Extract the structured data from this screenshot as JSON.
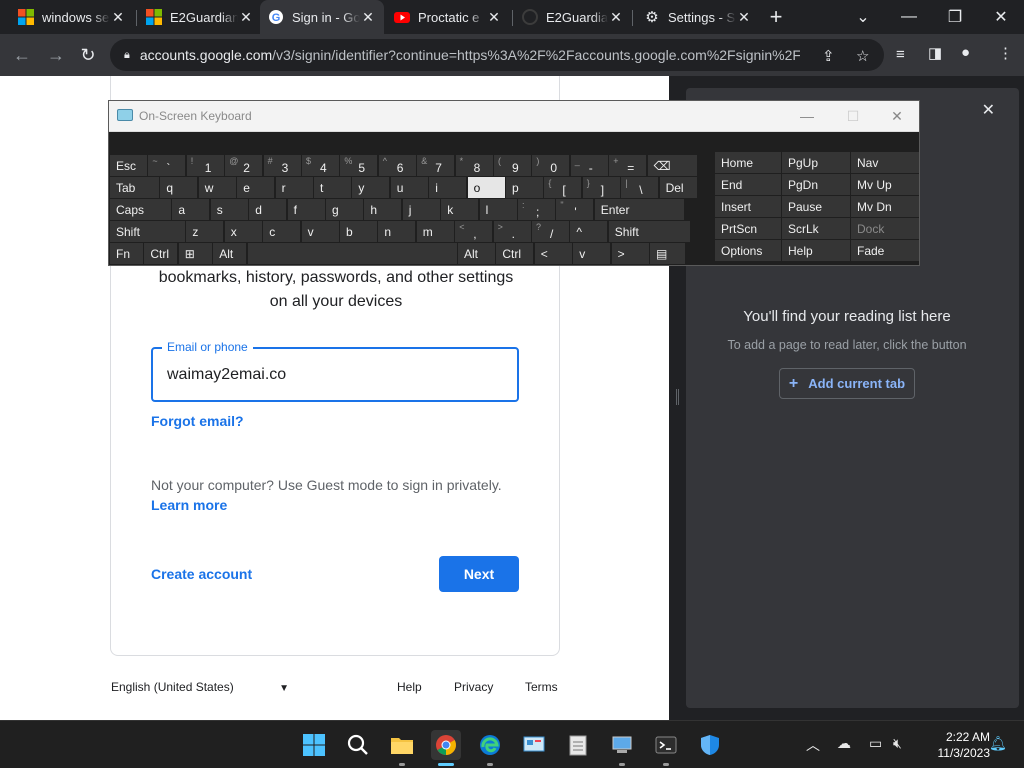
{
  "browser": {
    "tabs": [
      {
        "title": "windows se",
        "favicon": "microsoft-logo-icon"
      },
      {
        "title": "E2Guardian",
        "favicon": "microsoft-logo-icon"
      },
      {
        "title": "Sign in - Go",
        "favicon": "google-g-icon"
      },
      {
        "title": "Proctatic e",
        "favicon": "youtube-icon"
      },
      {
        "title": "E2Guardian",
        "favicon": "github-icon"
      },
      {
        "title": "Settings - S",
        "favicon": "gear-icon"
      }
    ],
    "active_tab": 2,
    "new_tab": "+",
    "url_host": "accounts.google.com",
    "url_rest": "/v3/signin/identifier?continue=https%3A%2F%2Faccounts.google.com%2Fsignin%2Fc...",
    "colors": {
      "frame": "#202124",
      "toolbar": "#35363a",
      "accent": "#1a73e8"
    }
  },
  "signin": {
    "subtitle_line1": "bookmarks, history, passwords, and other settings",
    "subtitle_line2": "on all your devices",
    "email_label": "Email or phone",
    "email_value": "waimay2emai.co",
    "forgot_email": "Forgot email?",
    "guest_text": "Not your computer? Use Guest mode to sign in privately.",
    "learn_more": "Learn more",
    "create_account": "Create account",
    "next": "Next",
    "language": "English (United States)",
    "footer_links": [
      "Help",
      "Privacy",
      "Terms"
    ]
  },
  "reading_list": {
    "title": "You'll find your reading list here",
    "subtitle": "To add a page to read later, click the button",
    "add_button": "Add current tab"
  },
  "osk": {
    "title": "On-Screen Keyboard",
    "rows": [
      [
        {
          "m": "Esc"
        },
        {
          "s": "~",
          "m": "`"
        },
        {
          "s": "!",
          "m": "1"
        },
        {
          "s": "@",
          "m": "2"
        },
        {
          "s": "#",
          "m": "3"
        },
        {
          "s": "$",
          "m": "4"
        },
        {
          "s": "%",
          "m": "5"
        },
        {
          "s": "^",
          "m": "6"
        },
        {
          "s": "&",
          "m": "7"
        },
        {
          "s": "*",
          "m": "8"
        },
        {
          "s": "(",
          "m": "9"
        },
        {
          "s": ")",
          "m": "0"
        },
        {
          "s": "_",
          "m": "-"
        },
        {
          "s": "+",
          "m": "="
        },
        {
          "m": "⌫"
        }
      ],
      [
        {
          "m": "Tab"
        },
        {
          "m": "q"
        },
        {
          "m": "w"
        },
        {
          "m": "e"
        },
        {
          "m": "r"
        },
        {
          "m": "t"
        },
        {
          "m": "y"
        },
        {
          "m": "u"
        },
        {
          "m": "i"
        },
        {
          "m": "o",
          "pressed": true
        },
        {
          "m": "p"
        },
        {
          "s": "{",
          "m": "["
        },
        {
          "s": "}",
          "m": "]"
        },
        {
          "s": "|",
          "m": "\\"
        },
        {
          "m": "Del"
        }
      ],
      [
        {
          "m": "Caps"
        },
        {
          "m": "a"
        },
        {
          "m": "s"
        },
        {
          "m": "d"
        },
        {
          "m": "f"
        },
        {
          "m": "g"
        },
        {
          "m": "h"
        },
        {
          "m": "j"
        },
        {
          "m": "k"
        },
        {
          "m": "l"
        },
        {
          "s": ":",
          "m": ";"
        },
        {
          "s": "\"",
          "m": "'"
        },
        {
          "m": "Enter"
        }
      ],
      [
        {
          "m": "Shift"
        },
        {
          "m": "z"
        },
        {
          "m": "x"
        },
        {
          "m": "c"
        },
        {
          "m": "v"
        },
        {
          "m": "b"
        },
        {
          "m": "n"
        },
        {
          "m": "m"
        },
        {
          "s": "<",
          "m": ","
        },
        {
          "s": ">",
          "m": "."
        },
        {
          "s": "?",
          "m": "/"
        },
        {
          "m": "^"
        },
        {
          "m": "Shift"
        }
      ],
      [
        {
          "m": "Fn"
        },
        {
          "m": "Ctrl"
        },
        {
          "m": "⊞",
          "icon": "windows-logo-icon"
        },
        {
          "m": "Alt"
        },
        {
          "m": ""
        },
        {
          "m": "Alt"
        },
        {
          "m": "Ctrl"
        },
        {
          "m": "<"
        },
        {
          "m": "v"
        },
        {
          "m": ">"
        },
        {
          "m": "▤"
        }
      ]
    ],
    "nav_keys": [
      [
        "Home",
        "PgUp",
        "Nav"
      ],
      [
        "End",
        "PgDn",
        "Mv Up"
      ],
      [
        "Insert",
        "Pause",
        "Mv Dn"
      ],
      [
        "PrtScn",
        "ScrLk",
        "Dock"
      ],
      [
        "Options",
        "Help",
        "Fade"
      ]
    ]
  },
  "taskbar": {
    "clock_time": "2:22 AM",
    "clock_date": "11/3/2023",
    "apps": [
      "windows-start-icon",
      "search-icon",
      "file-explorer-icon",
      "chrome-icon",
      "edge-icon",
      "control-panel-icon",
      "notepad-icon",
      "device-manager-icon",
      "terminal-icon",
      "defender-shield-icon"
    ]
  }
}
